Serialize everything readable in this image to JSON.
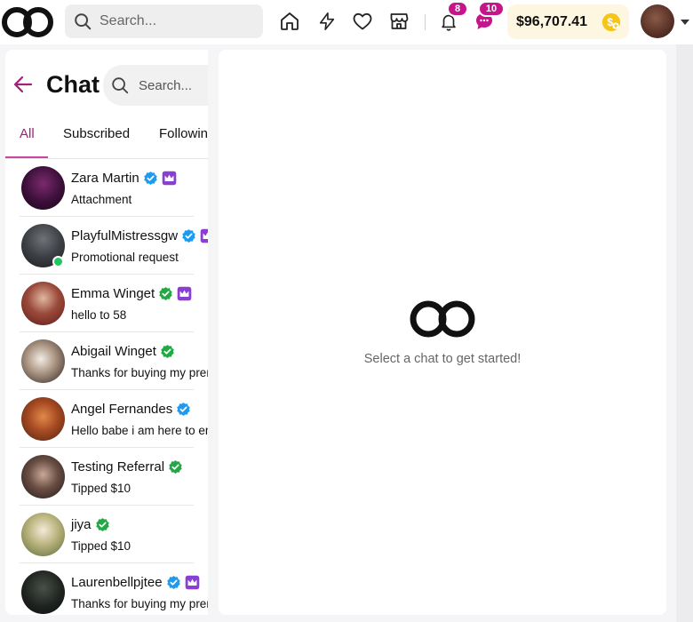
{
  "header": {
    "search_placeholder": "Search...",
    "notifications_count": "8",
    "messages_count": "10",
    "wallet_balance": "$96,707.41"
  },
  "icons": [
    "logo-icon",
    "search-icon",
    "home-icon",
    "bolt-icon",
    "heart-icon",
    "store-icon",
    "bell-icon",
    "chat-bubble-icon",
    "coin-icon",
    "chevron-down-icon",
    "arrow-left-icon",
    "verified-icon",
    "crown-icon"
  ],
  "chat_panel": {
    "title": "Chat",
    "search_placeholder": "Search...",
    "tabs": [
      {
        "label": "All",
        "active": true
      },
      {
        "label": "Subscribed",
        "active": false
      },
      {
        "label": "Following",
        "active": false
      }
    ],
    "conversations": [
      {
        "name": "Zara Martin",
        "message": "Attachment",
        "verified": "blue",
        "crown": true,
        "online": false
      },
      {
        "name": "PlayfulMistressgw",
        "message": "Promotional request",
        "verified": "blue",
        "crown": true,
        "online": true
      },
      {
        "name": "Emma Winget",
        "message": "hello to 58",
        "verified": "green",
        "crown": true,
        "online": false
      },
      {
        "name": "Abigail Winget",
        "message": "Thanks for buying my premium",
        "verified": "green",
        "crown": false,
        "online": false
      },
      {
        "name": "Angel Fernandes",
        "message": "Hello babe i am here to entertain",
        "verified": "blue",
        "crown": false,
        "online": false
      },
      {
        "name": "Testing Referral",
        "message": "Tipped $10",
        "verified": "green",
        "crown": false,
        "online": false
      },
      {
        "name": "jiya",
        "message": "Tipped $10",
        "verified": "green",
        "crown": false,
        "online": false
      },
      {
        "name": "Laurenbellpjtee",
        "message": "Thanks for buying my premium",
        "verified": "blue",
        "crown": true,
        "online": false
      }
    ]
  },
  "main": {
    "empty_state_text": "Select a chat to get started!"
  },
  "colors": {
    "accent": "#c4168a",
    "verified_blue": "#1d9bf0",
    "verified_green": "#22a845",
    "crown_purple": "#8b3fd1",
    "coin_yellow": "#f5c518",
    "wallet_bg": "#fdf6e0"
  }
}
